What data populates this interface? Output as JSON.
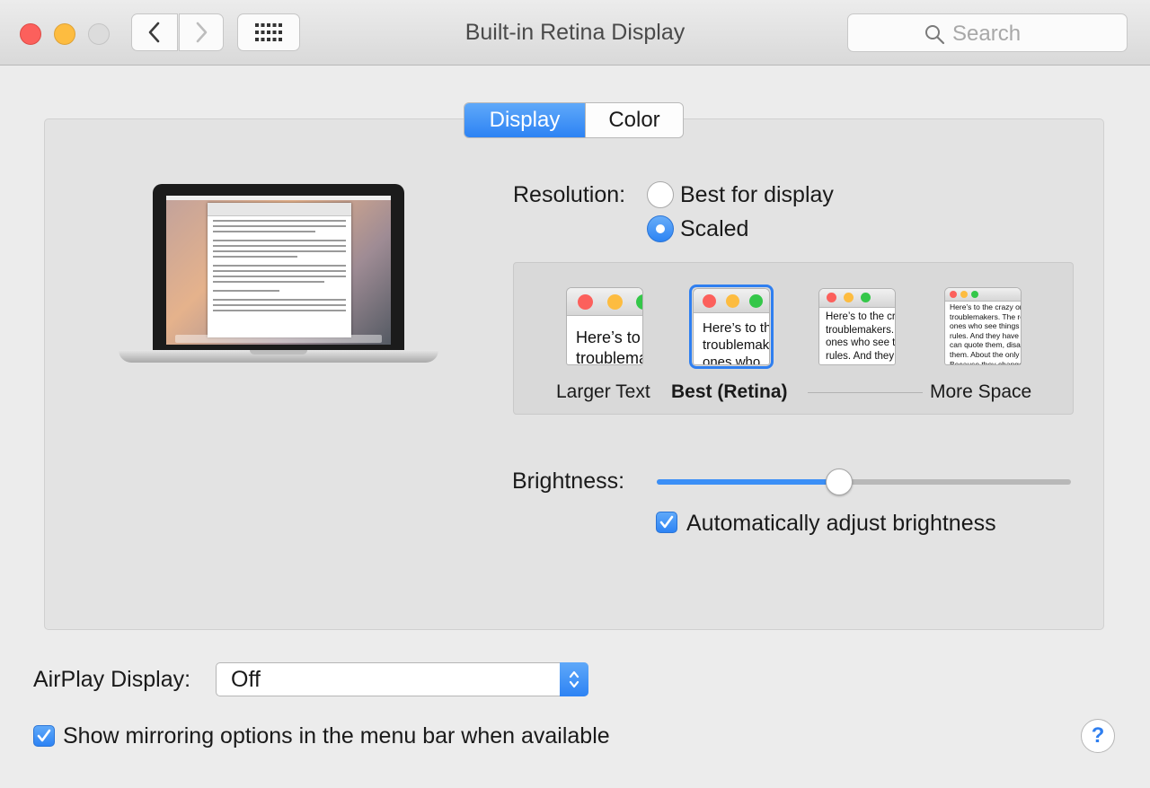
{
  "window": {
    "title": "Built-in Retina Display"
  },
  "toolbar": {
    "back": "back",
    "forward": "forward",
    "grid": "show-all"
  },
  "search": {
    "placeholder": "Search"
  },
  "tabs": [
    {
      "label": "Display",
      "active": true
    },
    {
      "label": "Color",
      "active": false
    }
  ],
  "resolution": {
    "label": "Resolution:",
    "options": [
      {
        "label": "Best for display",
        "selected": false
      },
      {
        "label": "Scaled",
        "selected": true
      }
    ]
  },
  "scaled_options": {
    "previews": [
      {
        "text": "Here’s to the troublemakers."
      },
      {
        "text": "Here’s to the troublemakers ones who"
      },
      {
        "text": "Here’s to the crazy troublemakers. The ones who see things rules. And they"
      },
      {
        "text": "Here’s to the crazy ones troublemakers. The round ones who see things diff rules. And they have no can quote them, disagree them. About the only th Because they change thi"
      }
    ],
    "labels": {
      "larger": "Larger Text",
      "best": "Best (Retina)",
      "more": "More Space"
    },
    "selected_index": 1
  },
  "brightness": {
    "label": "Brightness:",
    "value": 0.44,
    "auto_label": "Automatically adjust brightness",
    "auto_checked": true
  },
  "airplay": {
    "label": "AirPlay Display:",
    "value": "Off"
  },
  "mirroring": {
    "label": "Show mirroring options in the menu bar when available",
    "checked": true
  },
  "help": {
    "label": "?"
  },
  "colors": {
    "accent": "#2d83f4",
    "close": "#fc605c",
    "minimize": "#fdbc40",
    "zoom": "#34c749"
  }
}
